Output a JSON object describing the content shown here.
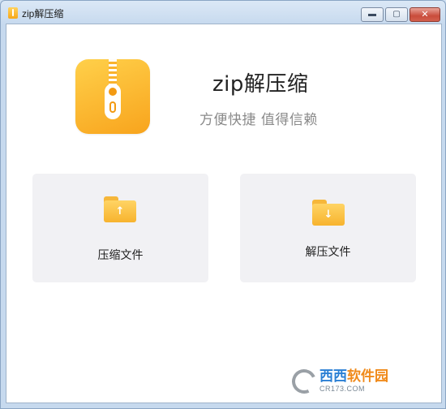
{
  "window": {
    "title": "zip解压缩",
    "controls": {
      "minimize": "▬",
      "maximize": "▢",
      "close": "✕"
    }
  },
  "header": {
    "app_title": "zip解压缩",
    "slogan": "方便快捷 值得信赖"
  },
  "actions": {
    "compress": {
      "label": "压缩文件",
      "icon": "folder-upload-icon",
      "arrow": "↑"
    },
    "extract": {
      "label": "解压文件",
      "icon": "folder-download-icon",
      "arrow": "↓"
    }
  },
  "watermark": {
    "text_a": "西西",
    "text_b": "软件园",
    "domain": "CR173.COM"
  },
  "colors": {
    "accent": "#f8a41d",
    "card_bg": "#f1f1f4",
    "slogan": "#8a8a8a"
  }
}
